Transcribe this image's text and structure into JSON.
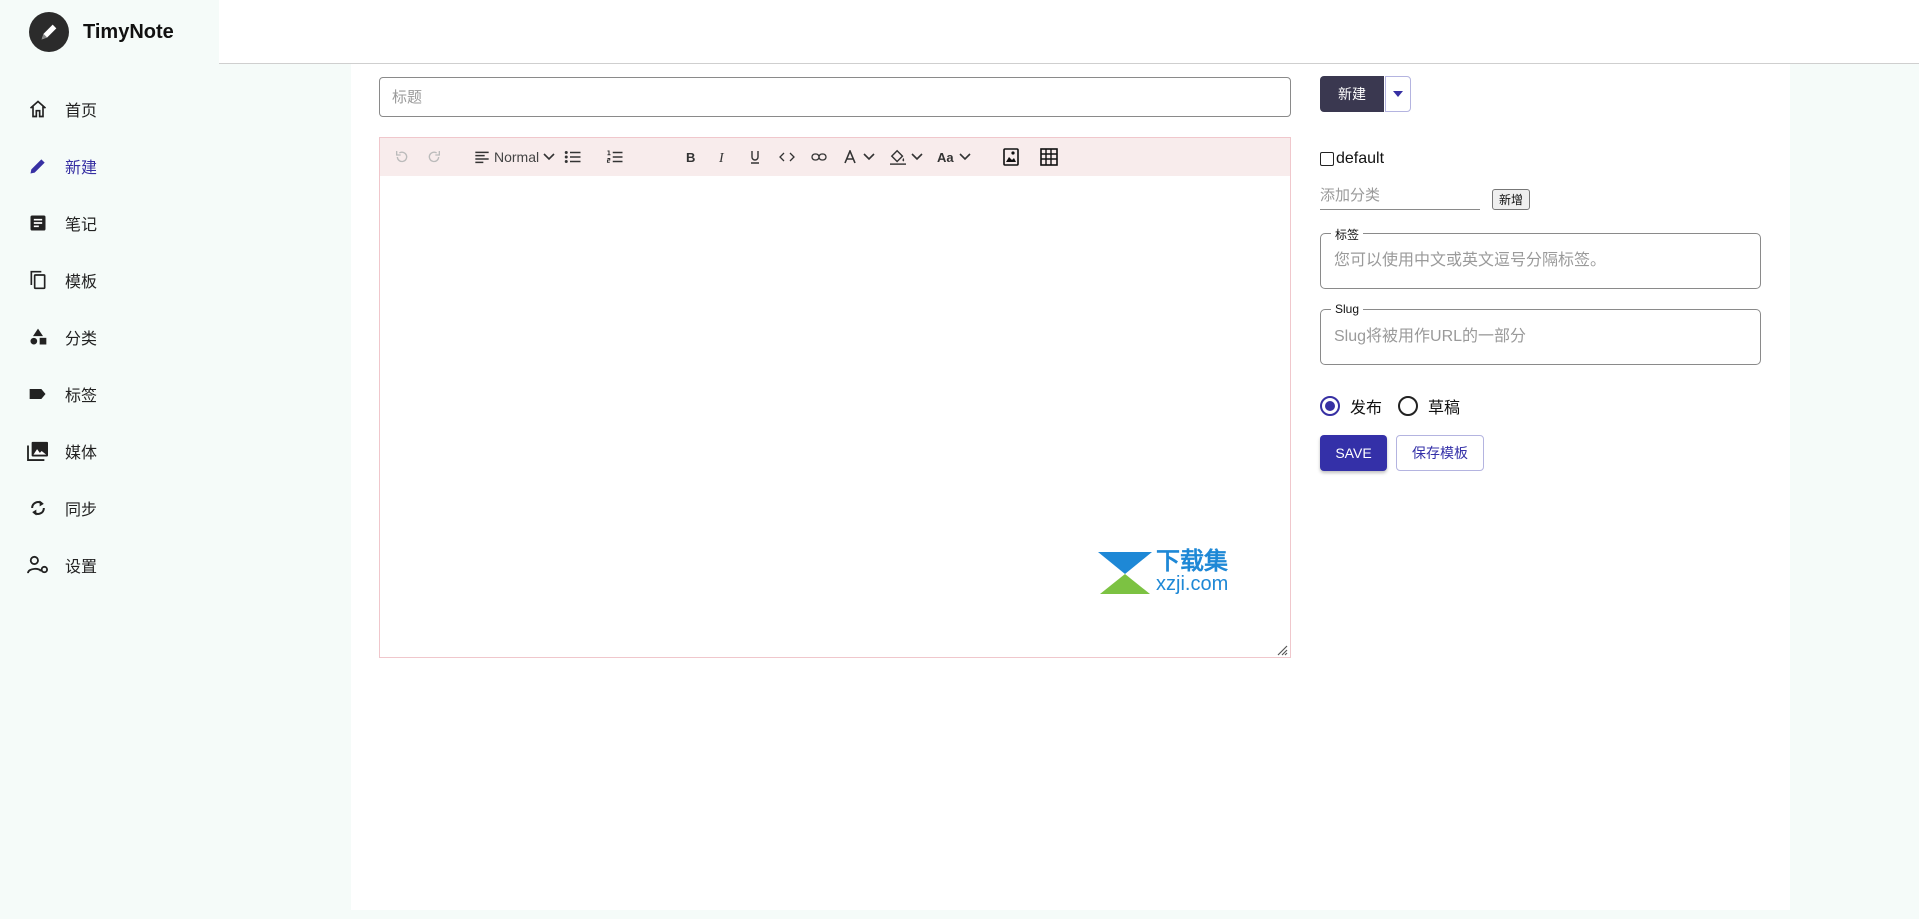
{
  "app": {
    "name": "TimyNote",
    "logo_icon": "pencil-icon"
  },
  "sidebar": {
    "items": [
      {
        "label": "首页",
        "icon": "home-icon",
        "active": false
      },
      {
        "label": "新建",
        "icon": "pencil-icon",
        "active": true
      },
      {
        "label": "笔记",
        "icon": "note-icon",
        "active": false
      },
      {
        "label": "模板",
        "icon": "copy-icon",
        "active": false
      },
      {
        "label": "分类",
        "icon": "shapes-icon",
        "active": false
      },
      {
        "label": "标签",
        "icon": "tag-icon",
        "active": false
      },
      {
        "label": "媒体",
        "icon": "photo-library-icon",
        "active": false
      },
      {
        "label": "同步",
        "icon": "sync-icon",
        "active": false
      },
      {
        "label": "设置",
        "icon": "user-settings-icon",
        "active": false
      }
    ]
  },
  "editor": {
    "title_placeholder": "标题",
    "toolbar": {
      "block_format": "Normal"
    }
  },
  "watermark": {
    "line1": "下载集",
    "line2": "xzji.com"
  },
  "panel": {
    "new_button": "新建",
    "default_checkbox": "default",
    "category_placeholder": "添加分类",
    "add_category_button": "新增",
    "tags": {
      "legend": "标签",
      "placeholder": "您可以使用中文或英文逗号分隔标签。"
    },
    "slug": {
      "legend": "Slug",
      "placeholder": "Slug将被用作URL的一部分"
    },
    "status": {
      "publish": "发布",
      "draft": "草稿",
      "selected": "publish"
    },
    "save_button": "SAVE",
    "save_template_button": "保存模板"
  },
  "colors": {
    "accent": "#3730a3",
    "primary_button": "#3430a8",
    "dark_button": "#3a3850",
    "sidebar_bg": "#f5fbf9",
    "toolbar_bg": "#f8ecec"
  }
}
